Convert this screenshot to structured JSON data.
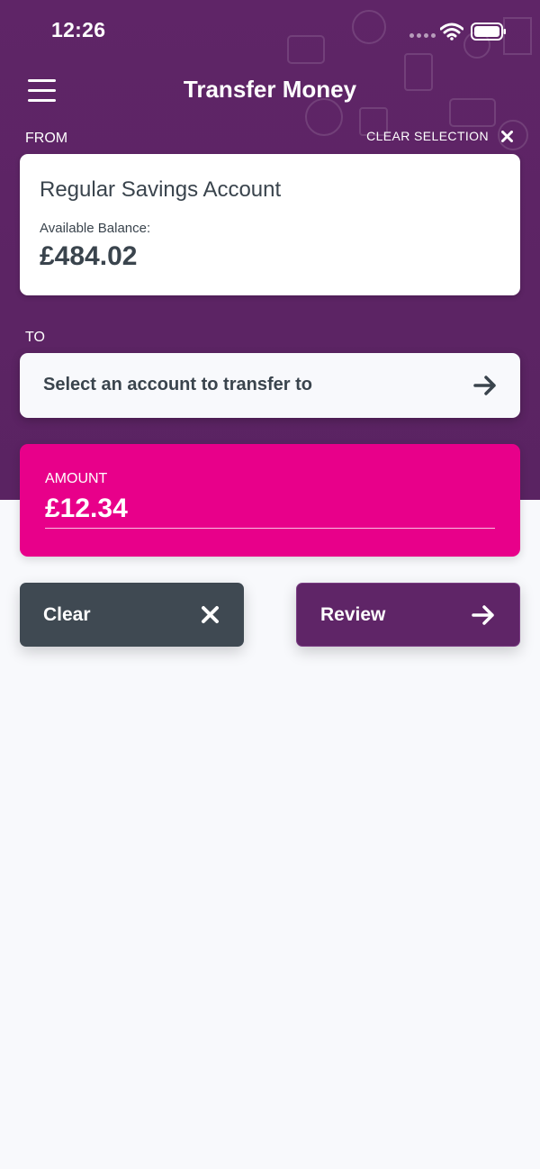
{
  "status_bar": {
    "time": "12:26"
  },
  "header": {
    "title": "Transfer Money"
  },
  "from": {
    "label": "FROM",
    "clear_selection": "CLEAR SELECTION",
    "account_name": "Regular Savings Account",
    "balance_label": "Available Balance:",
    "balance_value": "£484.02"
  },
  "to": {
    "label": "TO",
    "placeholder": "Select an account to transfer to"
  },
  "amount": {
    "label": "AMOUNT",
    "value": "£12.34"
  },
  "actions": {
    "clear_label": "Clear",
    "review_label": "Review"
  },
  "colors": {
    "header": "#5f2567",
    "amount_card": "#e8008a",
    "clear_button": "#3f4952",
    "review_button": "#5f2567",
    "text_dark": "#3a444d"
  },
  "icons": {
    "menu": "hamburger-icon",
    "clear_selection": "close-icon",
    "to_account": "arrow-right-icon",
    "clear": "close-icon",
    "review": "arrow-right-icon"
  }
}
